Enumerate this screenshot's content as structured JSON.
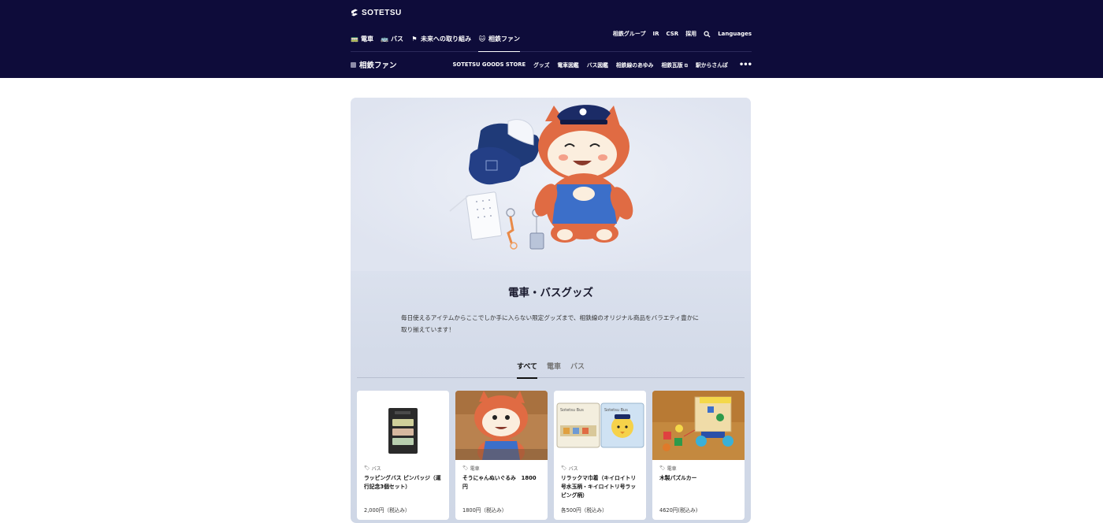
{
  "header": {
    "logo_text": "SOTETSU",
    "main_nav": [
      {
        "label": "電車",
        "icon": "train-icon",
        "glyph": "🚃"
      },
      {
        "label": "バス",
        "icon": "bus-icon",
        "glyph": "🚌"
      },
      {
        "label": "未来への取り組み",
        "icon": "flag-icon",
        "glyph": "⚑"
      },
      {
        "label": "相鉄ファン",
        "icon": "cat-icon",
        "glyph": "🐱"
      }
    ],
    "right_nav": {
      "group": "相鉄グループ",
      "ir": "IR",
      "csr": "CSR",
      "recruit": "採用",
      "languages": "Languages"
    },
    "sub_title": "相鉄ファン",
    "sub_nav": [
      "SOTETSU GOODS STORE",
      "グッズ",
      "電車図鑑",
      "バス図鑑",
      "相鉄線のあゆみ",
      "相鉄瓦版",
      "駅からさんぽ"
    ],
    "more": "•••"
  },
  "hero": {
    "title": "電車・バスグッズ",
    "description": "毎日使えるアイテムからここでしか手に入らない限定グッズまで、相鉄線のオリジナル商品をバラエティ豊かに取り揃えています！"
  },
  "tabs": [
    "すべて",
    "電車",
    "バス"
  ],
  "products": [
    {
      "tag": "バス",
      "name": "ラッピングバス ピンバッジ（運行記念3個セット）",
      "price": "2,000円（税込み）"
    },
    {
      "tag": "電車",
      "name": "そうにゃんぬいぐるみ　1800円",
      "price": "1800円（税込み）"
    },
    {
      "tag": "バス",
      "name": "リラックマ巾着（キイロイトリ号水玉柄・キイロイトリ号ラッピング柄）",
      "price": "各500円（税込み）"
    },
    {
      "tag": "電車",
      "name": "木製パズルカー",
      "price": "4620円(税込み)"
    }
  ],
  "colors": {
    "header_bg": "#0e0c3a",
    "card_bg": "#dde3ef",
    "mascot_orange": "#e06b43",
    "mascot_blue": "#3c6fc9"
  }
}
